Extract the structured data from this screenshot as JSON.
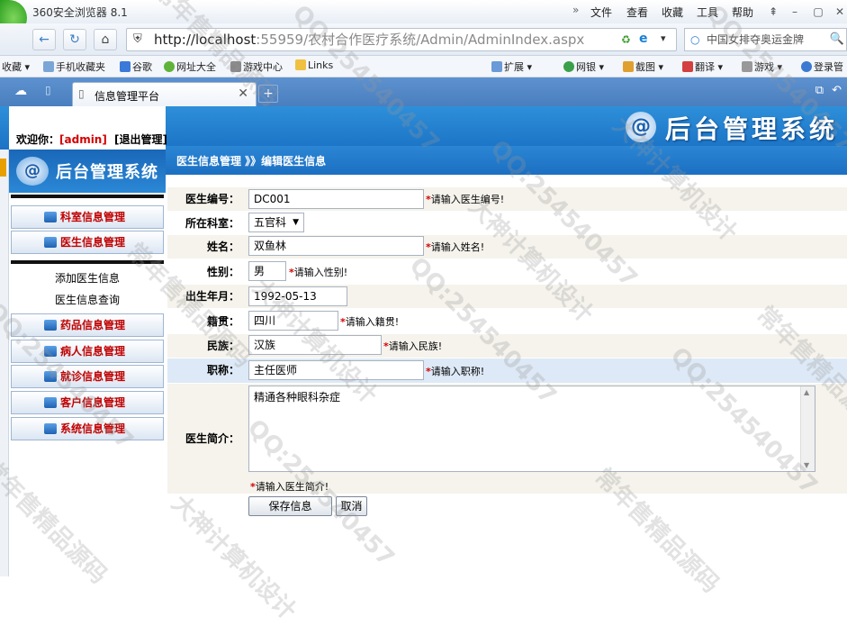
{
  "browser": {
    "title": "360安全浏览器 8.1",
    "menu": [
      "文件",
      "查看",
      "收藏",
      "工具",
      "帮助"
    ],
    "url_host": "http://localhost",
    "url_rest": ":55959/农村合作医疗系统/Admin/AdminIndex.aspx",
    "search_text": "中国女排夺奥运金牌",
    "favorites": [
      "收藏",
      "手机收藏夹",
      "谷歌",
      "网址大全",
      "游戏中心",
      "Links"
    ],
    "right_tools": [
      "扩展",
      "网银",
      "截图",
      "翻译",
      "游戏",
      "登录管"
    ],
    "tab_title": "信息管理平台"
  },
  "app": {
    "brand": "后台管理系统",
    "welcome_prefix": "欢迎你：",
    "welcome_user": "[admin]",
    "logout": "[退出管理]",
    "side_logo": "后台管理系统",
    "nav": {
      "dept": "科室信息管理",
      "doctor": "医生信息管理",
      "sub_add": "添加医生信息",
      "sub_query": "医生信息查询",
      "drug": "药品信息管理",
      "patient": "病人信息管理",
      "visit": "就诊信息管理",
      "customer": "客户信息管理",
      "system": "系统信息管理"
    },
    "breadcrumb": "医生信息管理 》》编辑医生信息"
  },
  "form": {
    "id_label": "医生编号：",
    "id_value": "DC001",
    "id_hint": "请输入医生编号!",
    "dept_label": "所在科室：",
    "dept_value": "五官科",
    "name_label": "姓名：",
    "name_value": "双鱼林",
    "name_hint": "请输入姓名!",
    "gender_label": "性别：",
    "gender_value": "男",
    "gender_hint": "请输入性别!",
    "birth_label": "出生年月：",
    "birth_value": "1992-05-13",
    "origin_label": "籍贯：",
    "origin_value": "四川",
    "origin_hint": "请输入籍贯!",
    "ethnic_label": "民族：",
    "ethnic_value": "汉族",
    "ethnic_hint": "请输入民族!",
    "title_label": "职称：",
    "title_value": "主任医师",
    "title_hint": "请输入职称!",
    "intro_label": "医生简介：",
    "intro_value": "精通各种眼科杂症",
    "intro_hint": "请输入医生简介!",
    "save_button": "保存信息",
    "cancel_button": "取消"
  },
  "watermarks": {
    "qq": "QQ:254540457",
    "design": "大神计算机设计",
    "source": "常年售精品源码"
  }
}
